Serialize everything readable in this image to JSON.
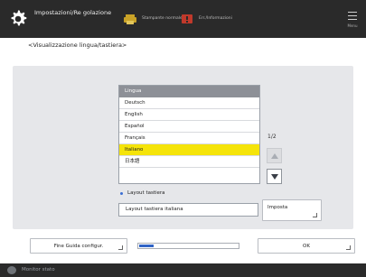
{
  "header": {
    "title": "Impostazioni/Re golazione",
    "items": [
      {
        "icon": "printer-status-icon",
        "label": "Stampante normale",
        "color": "#c9a227"
      },
      {
        "icon": "error-status-icon",
        "label": "Err./Informazioni",
        "color": "#c0392b"
      }
    ],
    "menu_label": "Menu"
  },
  "page": {
    "title": "<Visualizzazione lingua/tastiera>"
  },
  "language_list": {
    "header": "Lingua",
    "items": [
      "Deutsch",
      "English",
      "Español",
      "Français",
      "Italiano",
      "日本語"
    ],
    "selected_index": 4,
    "page_indicator": "1/2"
  },
  "keyboard": {
    "label": "Layout tastiera",
    "value": "Layout tastiera italiana",
    "set_button": "Imposta"
  },
  "footer": {
    "finish_button": "Fine Guida configur.",
    "progress": 0.15,
    "ok_button": "OK"
  },
  "status_bar": {
    "monitor_label": "Monitor stato"
  },
  "colors": {
    "selected_row": "#f5e40a",
    "accent": "#2f63c6",
    "topbar": "#2a2a2a"
  }
}
